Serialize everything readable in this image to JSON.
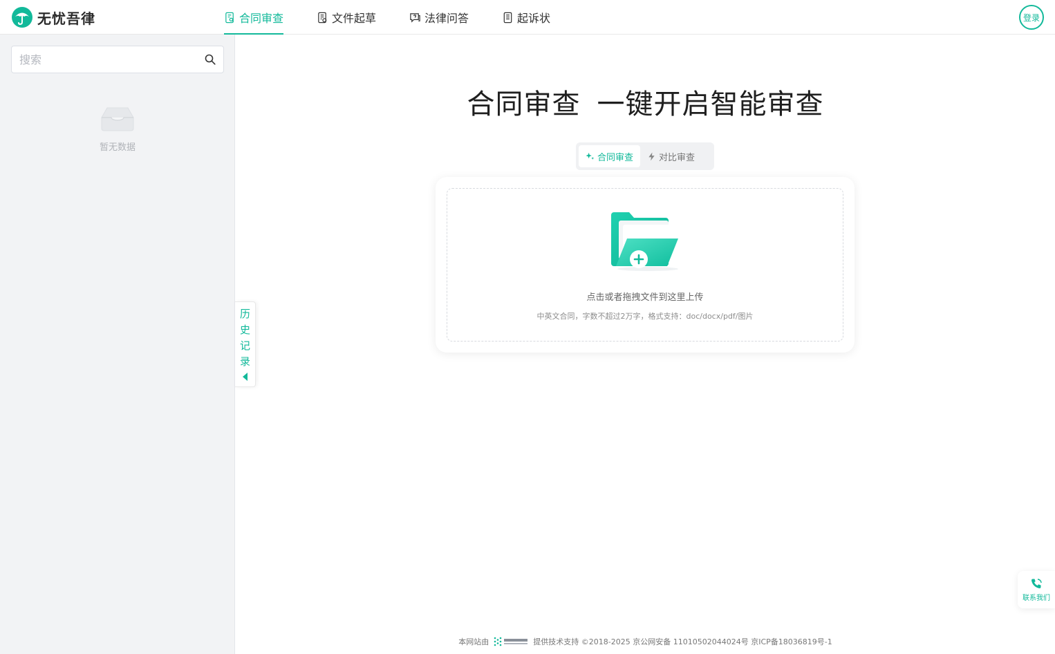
{
  "colors": {
    "accent": "#12b99a",
    "sidebar_bg": "#f2f3f5"
  },
  "header": {
    "logo_icon": "umbrella-logo-icon",
    "brand": "无忧吾律",
    "nav": [
      {
        "label": "合同审查",
        "icon": "contract-review-icon",
        "active": true
      },
      {
        "label": "文件起草",
        "icon": "document-draft-icon",
        "active": false
      },
      {
        "label": "法律问答",
        "icon": "chat-question-icon",
        "active": false
      },
      {
        "label": "起诉状",
        "icon": "complaint-doc-icon",
        "active": false
      }
    ],
    "login_label": "登录"
  },
  "sidebar": {
    "search_placeholder": "搜索",
    "search_icon": "search-icon",
    "empty_icon": "empty-inbox-icon",
    "empty_text": "暂无数据",
    "history_chars": [
      "历",
      "史",
      "记",
      "录"
    ],
    "history_arrow_icon": "caret-left-icon"
  },
  "main": {
    "title_part1": "合同审查",
    "title_part2": "一键开启智能审查",
    "modes": [
      {
        "label": "合同审查",
        "icon": "sparkle-icon",
        "active": true
      },
      {
        "label": "对比审查",
        "icon": "lightning-icon",
        "active": false
      }
    ],
    "upload": {
      "icon": "folder-add-icon",
      "text": "点击或者拖拽文件到这里上传",
      "hint": "中英文合同，字数不超过2万字，格式支持：doc/docx/pdf/图片"
    }
  },
  "footer": {
    "prefix": "本网站由",
    "partner_logo": "partner-logo",
    "rest": "提供技术支持 ©2018-2025 京公网安备 11010502044024号 京ICP备18036819号-1"
  },
  "contact": {
    "icon": "phone-icon",
    "label": "联系我们"
  }
}
